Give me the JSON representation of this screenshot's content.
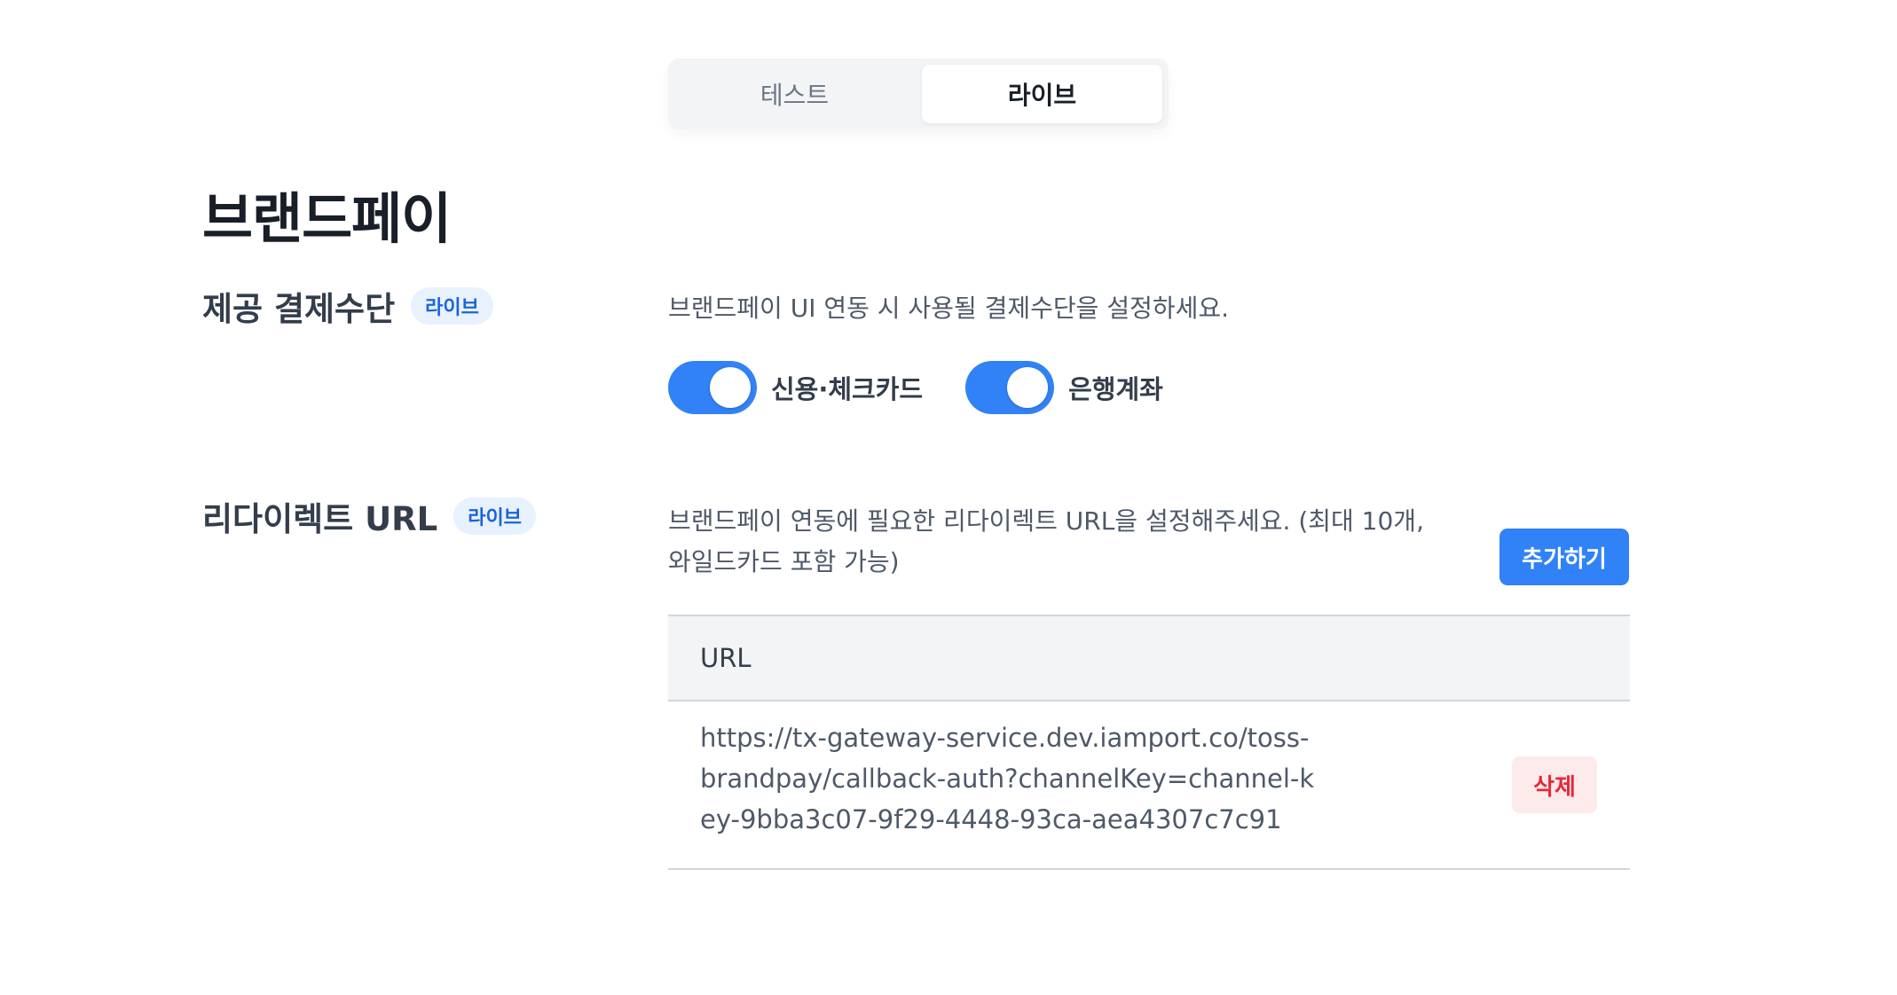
{
  "mode_switch": {
    "tabs": [
      {
        "label": "테스트",
        "active": false
      },
      {
        "label": "라이브",
        "active": true
      }
    ]
  },
  "page": {
    "title": "브랜드페이"
  },
  "payment_methods": {
    "label": "제공 결제수단",
    "badge": "라이브",
    "description": "브랜드페이 UI 연동 시 사용될 결제수단을 설정하세요.",
    "toggles": [
      {
        "label": "신용·체크카드",
        "on": true
      },
      {
        "label": "은행계좌",
        "on": true
      }
    ]
  },
  "redirect_url": {
    "label": "리다이렉트 URL",
    "badge": "라이브",
    "description_line1": "브랜드페이 연동에 필요한 리다이렉트 URL을 설정해주세요. (최대 10개,",
    "description_line2": "와일드카드 포함 가능)",
    "add_button": "추가하기",
    "table": {
      "header": "URL",
      "rows": [
        {
          "url": "https://tx-gateway-service.dev.iamport.co/toss-brandpay/callback-auth?channelKey=channel-key-9bba3c07-9f29-4448-93ca-aea4307c7c91",
          "delete_label": "삭제"
        }
      ]
    }
  },
  "colors": {
    "accent": "#3182f6",
    "badge_bg": "#e8f1fe",
    "badge_text": "#1b64da",
    "delete_bg": "#fdeaea",
    "delete_text": "#e42939",
    "table_header_bg": "#f2f4f6"
  }
}
